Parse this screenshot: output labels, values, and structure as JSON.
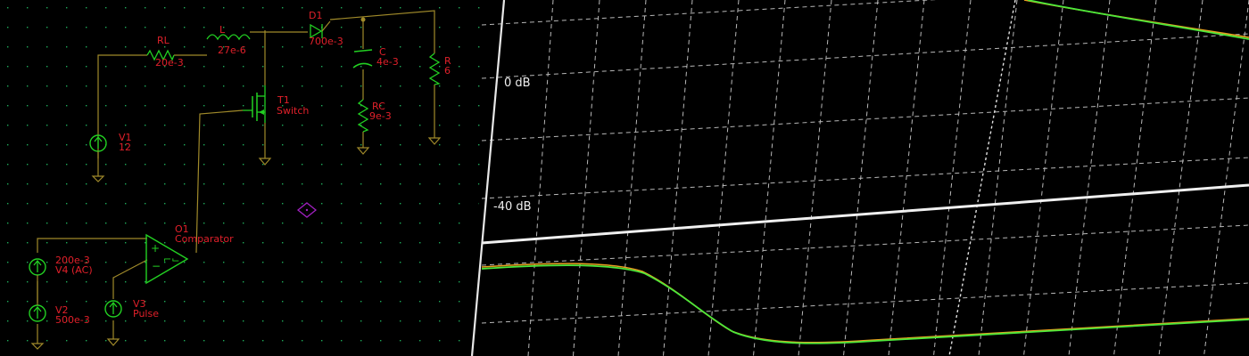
{
  "colors": {
    "background": "#000000",
    "grid_dots": "#1faa5a",
    "wire": "#a08a2a",
    "component": "#22d022",
    "label": "#e0202a",
    "probe": "#a020c0",
    "plot_grid": "#b8b8b8",
    "plot_axis": "#e0e0e0",
    "trace_green": "#4ce83a",
    "trace_orange": "#e8a020",
    "trace_white": "#e8e8e8"
  },
  "schematic": {
    "components": {
      "RL": {
        "name": "RL",
        "value": "20e-3"
      },
      "L": {
        "name": "L",
        "value": "27e-6"
      },
      "D1": {
        "name": "D1",
        "value": "700e-3"
      },
      "C": {
        "name": "C",
        "value": "4e-3"
      },
      "R": {
        "name": "R",
        "value": "6"
      },
      "RC": {
        "name": "RC",
        "value": "9e-3"
      },
      "T1": {
        "name": "T1",
        "value": "Switch"
      },
      "V1": {
        "name": "V1",
        "value": "12"
      },
      "O1": {
        "name": "O1",
        "value": "Comparator"
      },
      "V4": {
        "name": "V4 (AC)",
        "value": "200e-3"
      },
      "V2": {
        "name": "V2",
        "value": "500e-3"
      },
      "V3": {
        "name": "V3",
        "value": "Pulse"
      }
    },
    "probe_icon": "diamond-probe-icon"
  },
  "plot": {
    "labels": {
      "zero_db": "0 dB",
      "minus40_db": "-40 dB"
    }
  }
}
